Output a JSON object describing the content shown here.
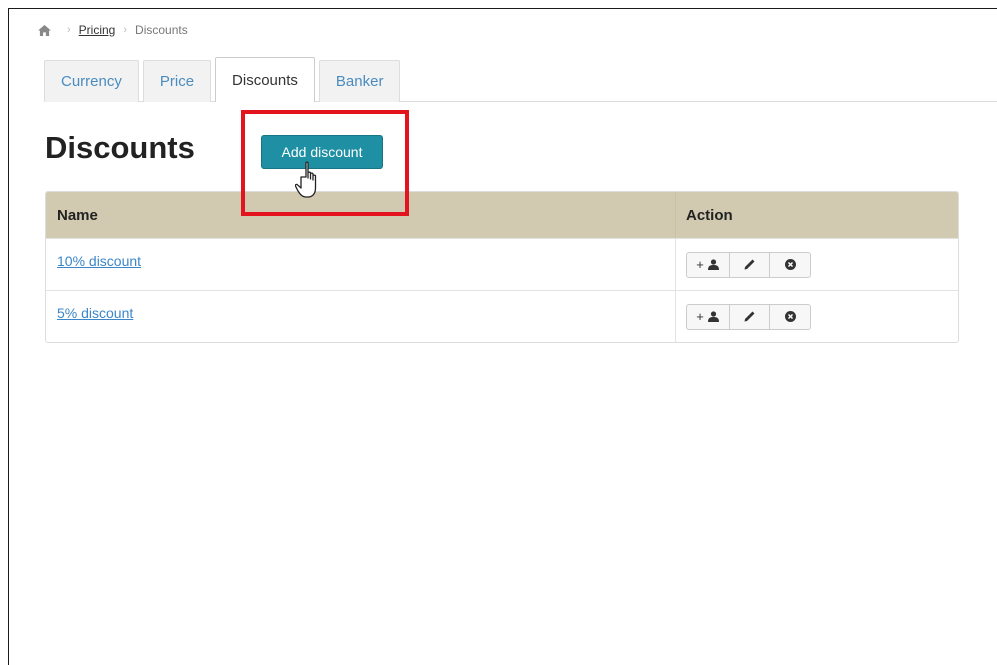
{
  "breadcrumb": {
    "home_icon": "home-icon",
    "items": [
      "Pricing",
      "Discounts"
    ]
  },
  "tabs": [
    {
      "label": "Currency",
      "active": false
    },
    {
      "label": "Price",
      "active": false
    },
    {
      "label": "Discounts",
      "active": true
    },
    {
      "label": "Banker",
      "active": false
    }
  ],
  "page": {
    "title": "Discounts",
    "add_button_label": "Add discount"
  },
  "table": {
    "columns": [
      "Name",
      "Action"
    ],
    "rows": [
      {
        "name": "10% discount"
      },
      {
        "name": "5% discount"
      }
    ],
    "actions": [
      {
        "label": "+",
        "icon": "user-icon"
      },
      {
        "icon": "pencil-icon"
      },
      {
        "icon": "close-circle-icon"
      }
    ]
  },
  "colors": {
    "accent_button": "#1f8fa3",
    "table_header": "#d1cab0",
    "link": "#3a86c8",
    "highlight": "#e4141f"
  }
}
